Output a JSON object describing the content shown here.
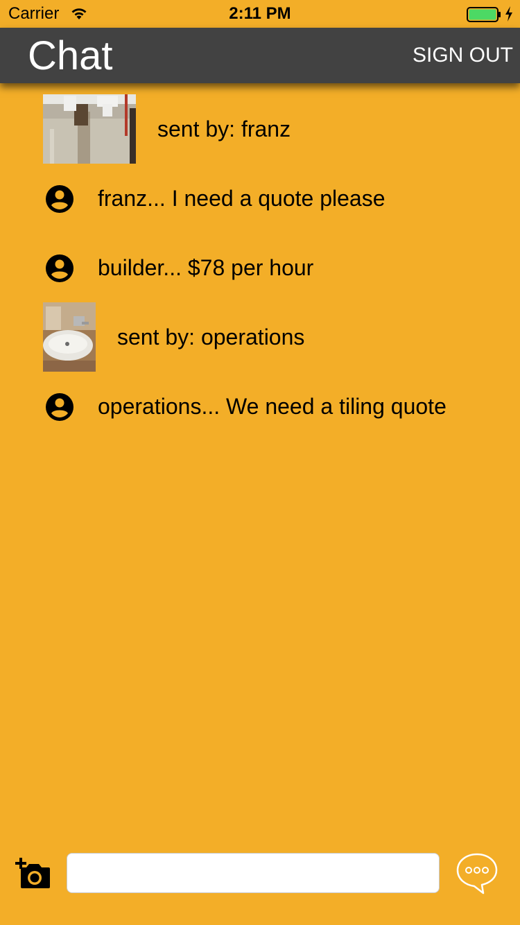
{
  "status_bar": {
    "carrier": "Carrier",
    "time": "2:11 PM",
    "battery_color": "#4CD964"
  },
  "header": {
    "title": "Chat",
    "sign_out_label": "SIGN OUT",
    "background_color": "#424242"
  },
  "theme": {
    "background_color": "#F3AE28"
  },
  "messages": [
    {
      "kind": "image",
      "text": "sent by: franz",
      "thumbnail": "pipe-photo"
    },
    {
      "kind": "text",
      "text": "franz... I need a quote please",
      "icon": "account-circle-icon"
    },
    {
      "kind": "text",
      "text": "builder... $78 per hour",
      "icon": "account-circle-icon"
    },
    {
      "kind": "image",
      "text": "sent by: operations",
      "thumbnail": "sink-photo"
    },
    {
      "kind": "text",
      "text": "operations... We need a tiling quote",
      "icon": "account-circle-icon"
    }
  ],
  "composer": {
    "input_value": "",
    "input_placeholder": "",
    "camera_icon": "add-photo-camera-icon",
    "send_icon": "chat-bubble-icon"
  }
}
